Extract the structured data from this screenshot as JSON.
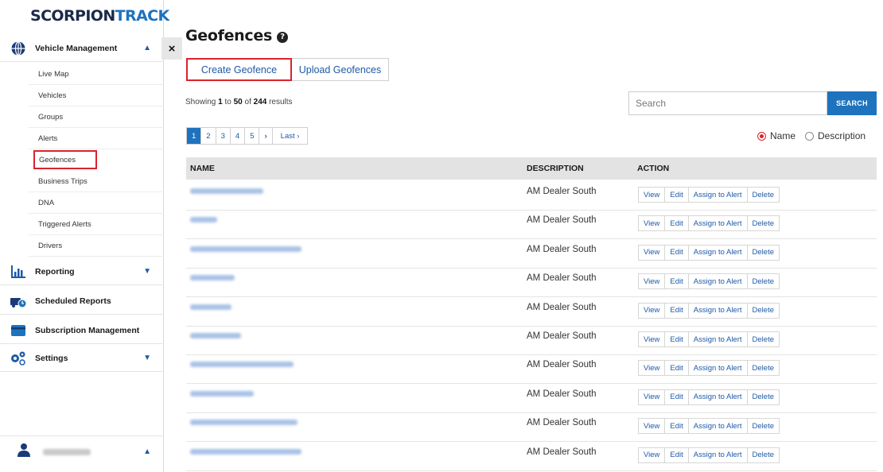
{
  "logo": {
    "part1": "SCORPION",
    "part2": "TRACK"
  },
  "sidebar": {
    "sections": [
      {
        "label": "Vehicle Management",
        "icon": "globe-icon",
        "caret": "▲"
      },
      {
        "label": "Reporting",
        "icon": "bar-chart-icon",
        "caret": "▼"
      },
      {
        "label": "Scheduled Reports",
        "icon": "truck-clock-icon"
      },
      {
        "label": "Subscription Management",
        "icon": "card-icon"
      },
      {
        "label": "Settings",
        "icon": "gears-icon",
        "caret": "▼"
      }
    ],
    "items": [
      "Live Map",
      "Vehicles",
      "Groups",
      "Alerts",
      "Geofences",
      "Business Trips",
      "DNA",
      "Triggered Alerts",
      "Drivers"
    ],
    "active_item": "Geofences",
    "close_label": "×",
    "user_caret": "▲"
  },
  "page": {
    "title": "Geofences",
    "help": "?",
    "create_label": "Create Geofence",
    "upload_label": "Upload Geofences",
    "showing_prefix": "Showing ",
    "showing_from": "1",
    "showing_mid": " to ",
    "showing_to": "50",
    "showing_of": " of ",
    "showing_total": "244",
    "showing_suffix": " results"
  },
  "search": {
    "placeholder": "Search",
    "button": "SEARCH"
  },
  "pagination": {
    "pages": [
      "1",
      "2",
      "3",
      "4",
      "5"
    ],
    "next": "›",
    "last": "Last ›",
    "current": "1"
  },
  "filter": {
    "options": [
      "Name",
      "Description"
    ],
    "selected": "Name"
  },
  "table": {
    "columns": [
      "NAME",
      "DESCRIPTION",
      "ACTION"
    ],
    "rows": [
      {
        "description": "AM Dealer South"
      },
      {
        "description": "AM Dealer South"
      },
      {
        "description": "AM Dealer South"
      },
      {
        "description": "AM Dealer South"
      },
      {
        "description": "AM Dealer South"
      },
      {
        "description": "AM Dealer South"
      },
      {
        "description": "AM Dealer South"
      },
      {
        "description": "AM Dealer South"
      },
      {
        "description": "AM Dealer South"
      },
      {
        "description": "AM Dealer South"
      }
    ],
    "actions": [
      "View",
      "Edit",
      "Assign to Alert",
      "Delete"
    ]
  },
  "colors": {
    "accent": "#1e73be",
    "highlight": "#d9232d",
    "link": "#1e5aa8"
  }
}
